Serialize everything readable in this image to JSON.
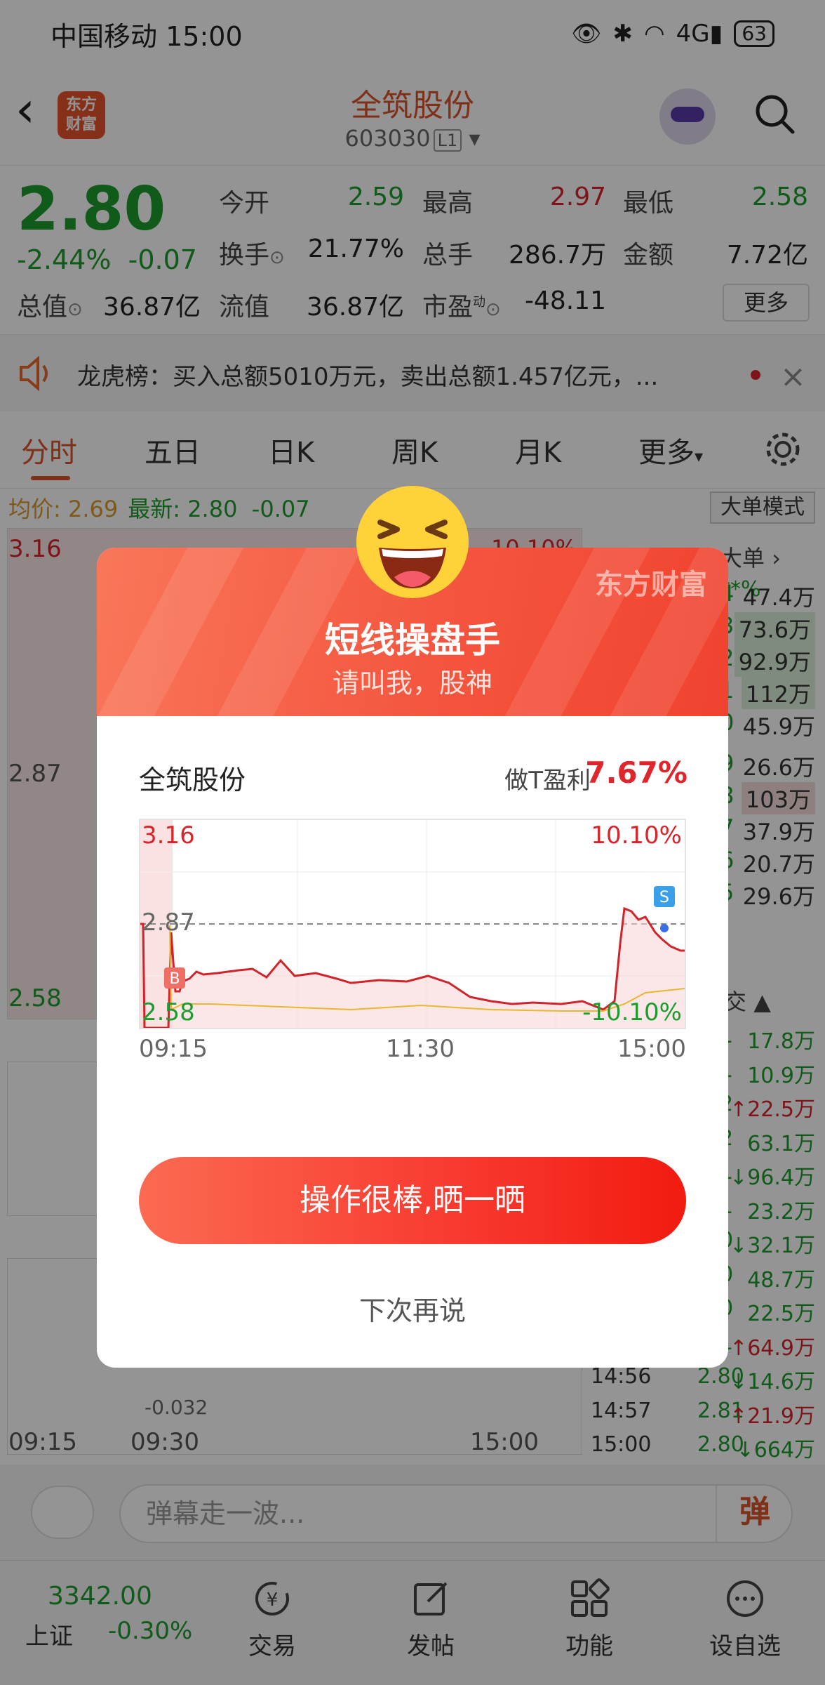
{
  "status_bar": {
    "carrier": "中国移动",
    "time": "15:00",
    "battery": "63",
    "network": "4G"
  },
  "header": {
    "stock_name": "全筑股份",
    "stock_code": "603030",
    "level_tag": "L1",
    "logo_text_1": "东方",
    "logo_text_2": "财富"
  },
  "quote": {
    "price": "2.80",
    "change_pct": "-2.44%",
    "change": "-0.07",
    "open_label": "今开",
    "open": "2.59",
    "high_label": "最高",
    "high": "2.97",
    "low_label": "最低",
    "low": "2.58",
    "turnover_label": "换手",
    "turnover": "21.77%",
    "volume_label": "总手",
    "volume": "286.7万",
    "amount_label": "金额",
    "amount": "7.72亿",
    "mktcap_label": "总值",
    "mktcap": "36.87亿",
    "float_label": "流值",
    "float": "36.87亿",
    "pe_label": "市盈",
    "pe_sup": "动",
    "pe": "-48.11",
    "more": "更多"
  },
  "notice": {
    "text": "龙虎榜：买入总额5010万元，卖出总额1.457亿元，..."
  },
  "tabs": [
    "分时",
    "五日",
    "日K",
    "周K",
    "月K",
    "更多"
  ],
  "avg_bar": {
    "avg_label": "均价:",
    "avg": "2.69",
    "last_label": "最新:",
    "last": "2.80",
    "chg": "-0.07",
    "big_order_mode": "大单模式"
  },
  "bg_chart": {
    "y_top": "3.16",
    "y_mid": "2.87",
    "y_bottom": "2.58",
    "pct_top": "10.10%",
    "macd_low": "-0.032",
    "x_labels": [
      "09:15",
      "09:30",
      "15:00"
    ],
    "big_order_header": "大单",
    "big_order_pct": "**%",
    "big_orders": [
      {
        "p": "4",
        "v": "47.4万"
      },
      {
        "p": "3",
        "v": "73.6万"
      },
      {
        "p": "2",
        "v": "92.9万"
      },
      {
        "p": "1",
        "v": "112万"
      },
      {
        "p": "0",
        "v": "45.9万"
      },
      {
        "p": "9",
        "v": "26.6万"
      },
      {
        "p": "8",
        "v": "103万"
      },
      {
        "p": "7",
        "v": "37.9万"
      },
      {
        "p": "6",
        "v": "20.7万"
      },
      {
        "p": "5",
        "v": "29.6万"
      }
    ],
    "trade_header": "交",
    "trades": [
      {
        "t": "",
        "p": "1",
        "v": "17.8万",
        "dir": ""
      },
      {
        "t": "",
        "p": "1",
        "v": "10.9万",
        "dir": ""
      },
      {
        "t": "",
        "p": "2",
        "v": "22.5万",
        "dir": "↑"
      },
      {
        "t": "",
        "p": "2",
        "v": "63.1万",
        "dir": ""
      },
      {
        "t": "",
        "p": "1",
        "v": "96.4万",
        "dir": "↓"
      },
      {
        "t": "",
        "p": "1",
        "v": "23.2万",
        "dir": ""
      },
      {
        "t": "",
        "p": "0",
        "v": "32.1万",
        "dir": "↓"
      },
      {
        "t": "",
        "p": "0",
        "v": "48.7万",
        "dir": ""
      },
      {
        "t": "",
        "p": "0",
        "v": "22.5万",
        "dir": ""
      },
      {
        "t": "",
        "p": "1",
        "v": "64.9万",
        "dir": "↑"
      },
      {
        "t": "14:56",
        "p": "2.80",
        "v": "14.6万",
        "dir": "↓"
      },
      {
        "t": "14:57",
        "p": "2.81",
        "v": "21.9万",
        "dir": "↑"
      },
      {
        "t": "15:00",
        "p": "2.80",
        "v": "664万",
        "dir": "↓"
      }
    ]
  },
  "danmu": {
    "placeholder": "弹幕走一波...",
    "send": "弹"
  },
  "bottom_nav": {
    "index_value": "3342.00",
    "index_name": "上证",
    "index_change": "-0.30%",
    "items": [
      "交易",
      "发帖",
      "功能",
      "设自选"
    ]
  },
  "dialog": {
    "brand": "东方财富",
    "title": "短线操盘手",
    "subtitle": "请叫我，股神",
    "stock_name": "全筑股份",
    "profit_label": "做T盈利",
    "profit": "7.67%",
    "chart": {
      "y_top": "3.16",
      "y_mid": "2.87",
      "y_bottom": "2.58",
      "pct_top": "10.10%",
      "pct_bottom": "-10.10%",
      "x_labels": [
        "09:15",
        "11:30",
        "15:00"
      ],
      "buy_marker": "B",
      "sell_marker": "S"
    },
    "share_button": "操作很棒,晒一晒",
    "later_button": "下次再说"
  },
  "colors": {
    "up": "#d9242b",
    "down": "#1c9b2e",
    "accent": "#f4553e"
  }
}
